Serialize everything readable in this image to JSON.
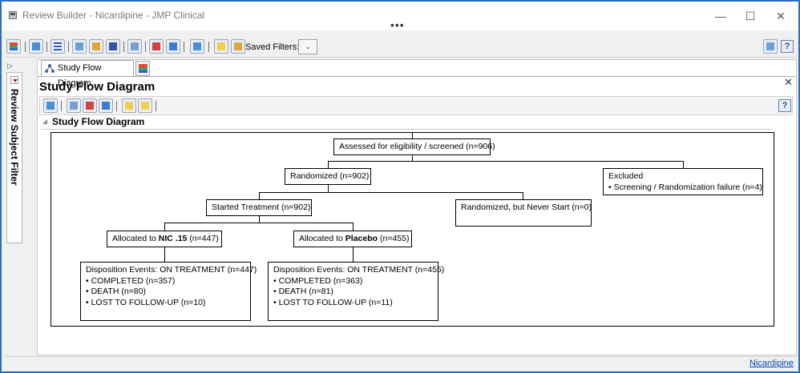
{
  "window": {
    "title": "Review Builder - Nicardipine - JMP Clinical",
    "controls": {
      "minimize": "—",
      "maximize": "☐",
      "close": "✕"
    },
    "more": "•••"
  },
  "toolbar": {
    "saved_filters_label": "Saved Filters:",
    "saved_filters_value": "⌄",
    "help": "?"
  },
  "side_panel": {
    "label": "Review Subject Filter",
    "collapse": "▷"
  },
  "tabs": [
    {
      "label": "Study Flow Diagram"
    }
  ],
  "report": {
    "title": "Study Flow Diagram",
    "outline_title": "Study Flow Diagram",
    "help": "?",
    "close": "✕"
  },
  "diagram": {
    "screened": "Assessed for eligibility / screened (n=906)",
    "randomized": "Randomized (n=902)",
    "excluded_title": "Excluded",
    "excluded_item": "• Screening / Randomization failure  (n=4)",
    "started": "Started Treatment (n=902)",
    "never_start": "Randomized, but Never Start (n=0)",
    "alloc_nic_prefix": "Allocated to ",
    "alloc_nic_bold": "NIC .15",
    "alloc_nic_suffix": " (n=447)",
    "alloc_pla_prefix": "Allocated to ",
    "alloc_pla_bold": "Placebo",
    "alloc_pla_suffix": " (n=455)",
    "disp_nic": {
      "title": "Disposition Events: ON TREATMENT (n=447)",
      "items": [
        "• COMPLETED (n=357)",
        "• DEATH (n=80)",
        "• LOST TO FOLLOW-UP (n=10)"
      ]
    },
    "disp_pla": {
      "title": "Disposition Events: ON TREATMENT (n=455)",
      "items": [
        "• COMPLETED (n=363)",
        "• DEATH (n=81)",
        "• LOST TO FOLLOW-UP (n=11)"
      ]
    }
  },
  "status": {
    "link": "Nicardipine"
  }
}
